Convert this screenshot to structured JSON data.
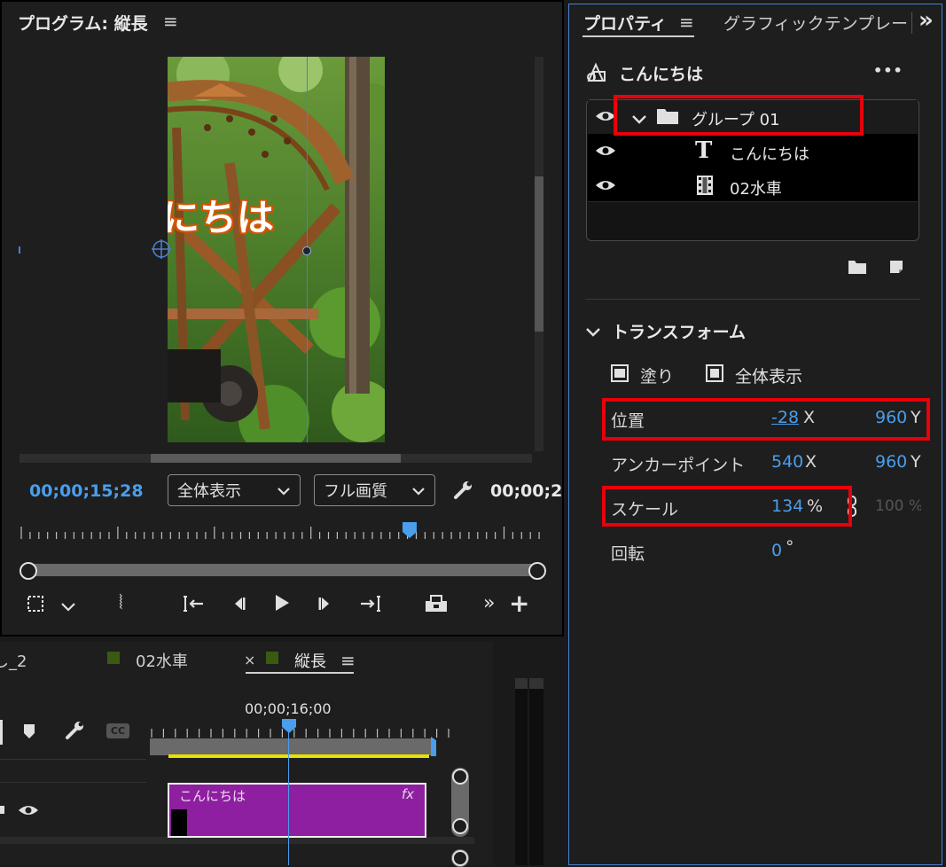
{
  "program_monitor": {
    "title": "プログラム: 縦長",
    "video_text": "にちは",
    "timecode_current": "00;00;15;28",
    "zoom_select": "全体表示",
    "quality_select": "フル画質",
    "timecode_duration": "00;00;2"
  },
  "timeline": {
    "tabs": [
      {
        "label": "し_2"
      },
      {
        "label": "02水車"
      },
      {
        "label": "縦長"
      }
    ],
    "close_glyph": "×",
    "timecode": "00;00;16;00",
    "cc_label": "CC",
    "clip": {
      "label": "こんにちは",
      "fx": "fx"
    }
  },
  "properties": {
    "tab_active": "プロパティ",
    "tab_other": "グラフィックテンプレー",
    "overflow_glyph": "»",
    "object_title": "こんにちは",
    "more_glyph": "•••",
    "layers": [
      {
        "name": "グループ 01",
        "type": "group"
      },
      {
        "name": "こんにちは",
        "type": "text"
      },
      {
        "name": "02水車",
        "type": "video"
      }
    ],
    "transform": {
      "heading": "トランスフォーム",
      "fill_label": "塗り",
      "fit_label": "全体表示",
      "position": {
        "label": "位置",
        "x": "-28",
        "x_unit": "X",
        "y": "960",
        "y_unit": "Y"
      },
      "anchor": {
        "label": "アンカーポイント",
        "x": "540",
        "x_unit": "X",
        "y": "960",
        "y_unit": "Y"
      },
      "scale": {
        "label": "スケール",
        "value": "134",
        "unit": "%",
        "value2": "100 %"
      },
      "rotation": {
        "label": "回転",
        "value": "0",
        "unit": "°"
      }
    }
  },
  "colors": {
    "accent": "#4a9eeb",
    "highlight_box": "#e8000b",
    "clip_purple": "#8e1fa0",
    "video_bar_yellow": "#e8e000"
  }
}
